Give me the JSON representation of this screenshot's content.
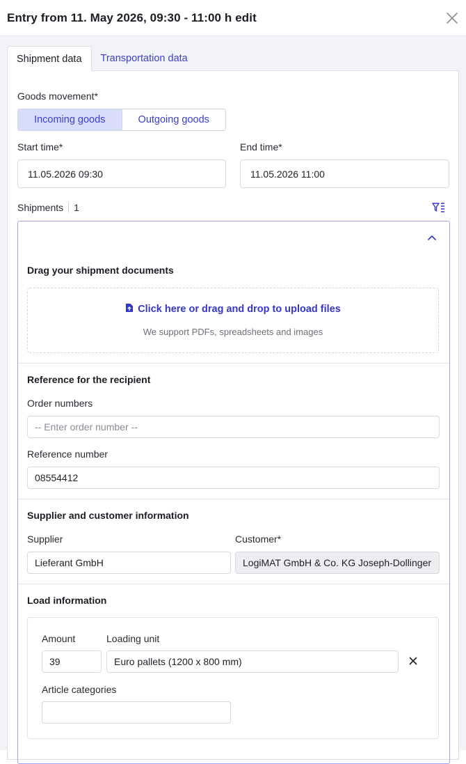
{
  "header": {
    "title": "Entry from 11. May 2026, 09:30 - 11:00 h edit"
  },
  "tabs": [
    {
      "label": "Shipment data"
    },
    {
      "label": "Transportation data"
    }
  ],
  "goods_movement": {
    "label": "Goods movement*",
    "options": [
      "Incoming goods",
      "Outgoing goods"
    ],
    "selected": "Incoming goods"
  },
  "start_time": {
    "label": "Start time*",
    "value": "11.05.2026 09:30"
  },
  "end_time": {
    "label": "End time*",
    "value": "11.05.2026 11:00"
  },
  "shipments": {
    "label": "Shipments",
    "count": "1"
  },
  "upload": {
    "title": "Drag your shipment documents",
    "link": "Click here or drag and drop to upload files",
    "hint": "We support PDFs, spreadsheets and images"
  },
  "reference": {
    "title": "Reference for the recipient",
    "order_label": "Order numbers",
    "order_placeholder": "-- Enter order number --",
    "ref_label": "Reference number",
    "ref_value": "08554412"
  },
  "supplier_customer": {
    "title": "Supplier and customer information",
    "supplier_label": "Supplier",
    "supplier_value": "Lieferant GmbH",
    "customer_label": "Customer*",
    "customer_value": "LogiMAT GmbH & Co. KG Joseph-Dollinger"
  },
  "load": {
    "title": "Load information",
    "amount_label": "Amount",
    "amount_value": "39",
    "unit_label": "Loading unit",
    "unit_value": "Euro pallets (1200 x 800 mm)",
    "categories_label": "Article categories",
    "categories_value": ""
  },
  "colors": {
    "accent": "#3437c9",
    "selected_segment": "#d9dcfb",
    "border_active": "#9fa3ef"
  }
}
